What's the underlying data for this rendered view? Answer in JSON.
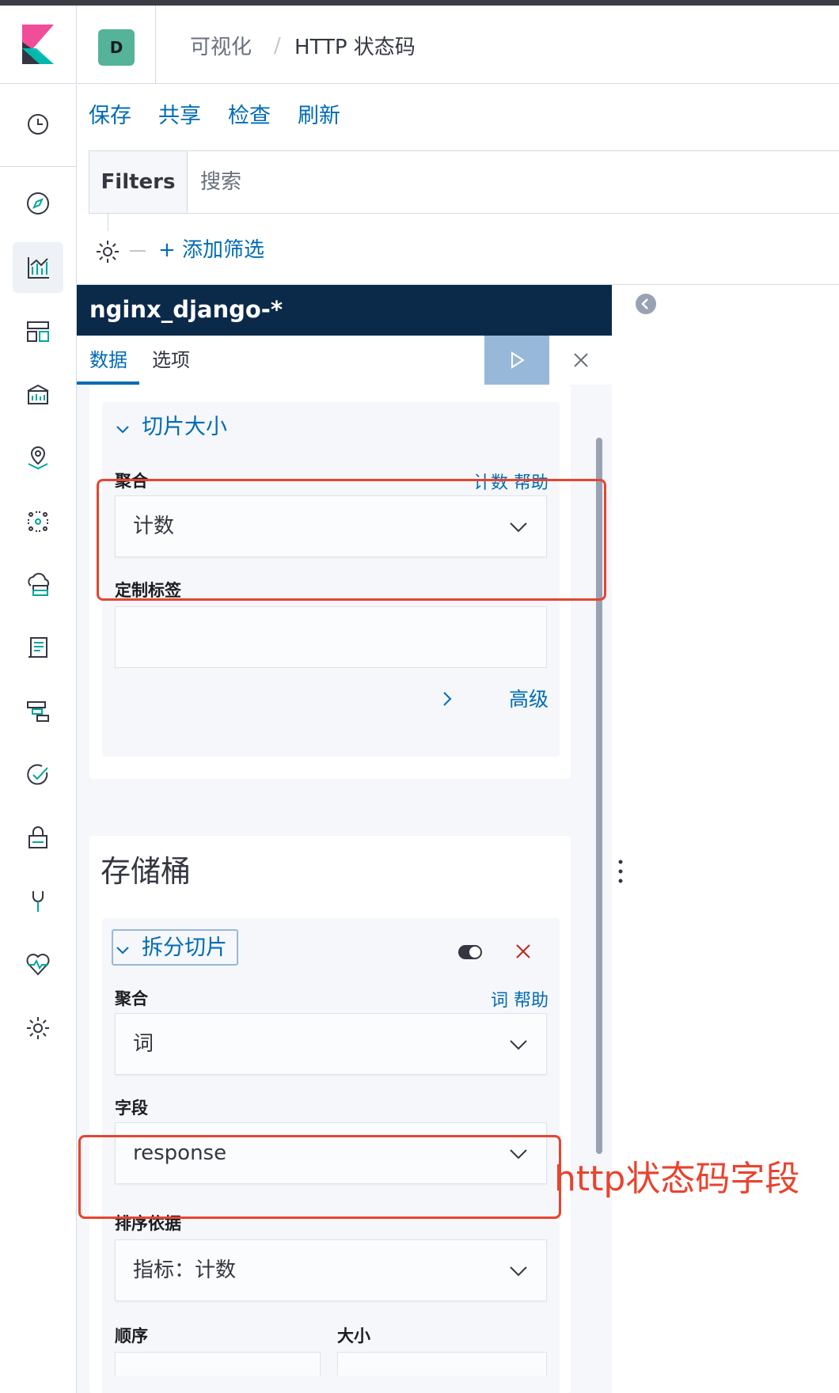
{
  "header": {
    "space_initial": "D",
    "breadcrumbs": [
      "可视化",
      "HTTP 状态码"
    ],
    "separator": "/"
  },
  "nav": {
    "items": [
      "clock-icon",
      "compass-icon",
      "visualize-icon",
      "dashboard-icon",
      "canvas-icon",
      "maps-icon",
      "ml-icon",
      "infrastructure-icon",
      "logs-icon",
      "apm-icon",
      "uptime-icon",
      "siem-icon",
      "dev-tools-icon",
      "monitoring-icon",
      "management-icon"
    ],
    "active": "visualize-icon"
  },
  "toolbar": {
    "save": "保存",
    "share": "共享",
    "inspect": "检查",
    "refresh": "刷新"
  },
  "query": {
    "filters_label": "Filters",
    "search_placeholder": "搜索",
    "add_filter": "+ 添加筛选"
  },
  "editor": {
    "index_pattern": "nginx_django-*",
    "tabs": [
      "数据",
      "选项"
    ],
    "metrics": {
      "accordion_title": "切片大小",
      "aggregation_label": "聚合",
      "aggregation_help": "计数 帮助",
      "aggregation_value": "计数",
      "custom_label": "定制标签",
      "custom_label_value": "",
      "advanced": "高级"
    },
    "buckets": {
      "title": "存储桶",
      "accordion_title": "拆分切片",
      "aggregation_label": "聚合",
      "aggregation_help": "词 帮助",
      "aggregation_value": "词",
      "field_label": "字段",
      "field_value": "response",
      "order_by_label": "排序依据",
      "order_by_value": "指标：计数",
      "order_label": "顺序",
      "size_label": "大小"
    }
  },
  "annotation": {
    "text": "http状态码字段",
    "color": "#e8442f"
  },
  "colors": {
    "link": "#006bb4",
    "index_bar": "#0b2a4a",
    "apply_button": "#98b8d9",
    "remove": "#bd271e"
  }
}
